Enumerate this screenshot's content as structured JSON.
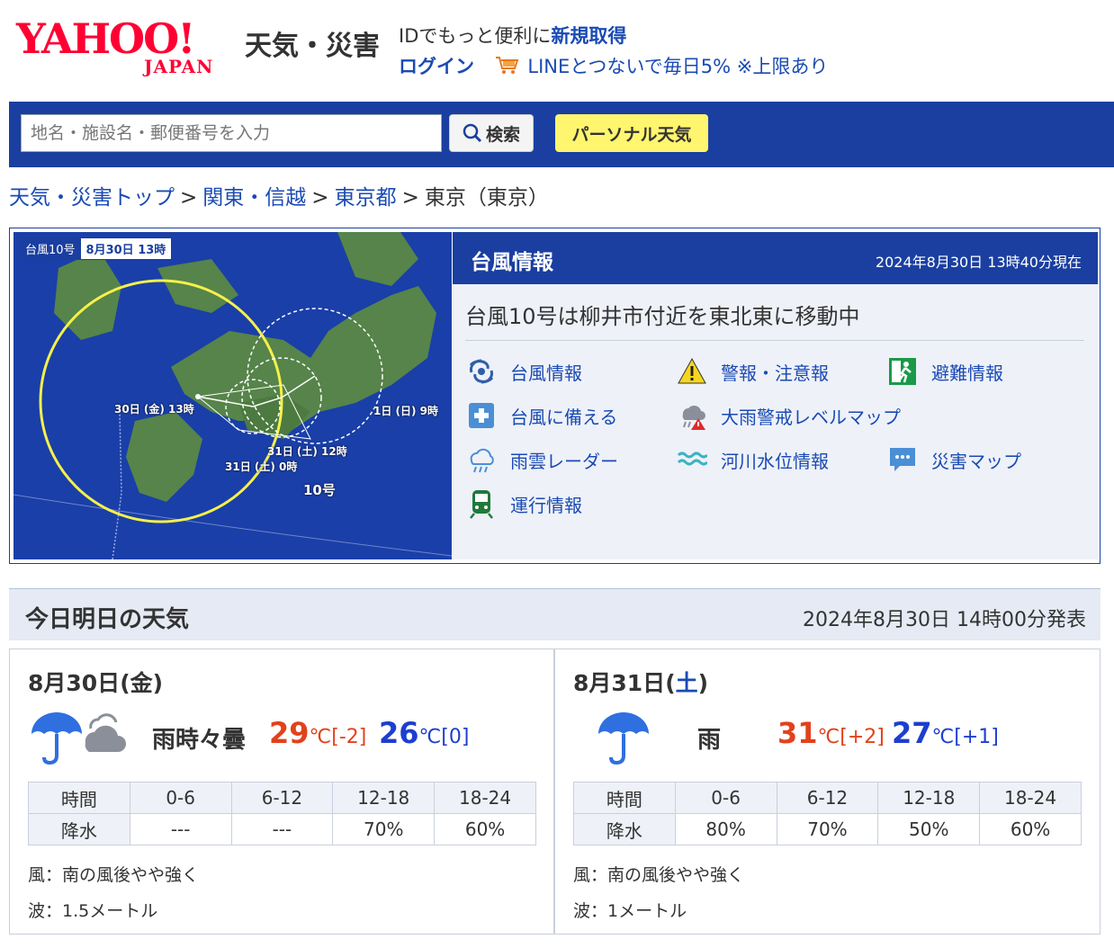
{
  "header": {
    "logo_text": "YAHOO!",
    "logo_sub": "JAPAN",
    "service_name": "天気・災害",
    "id_prompt": "IDでもっと便利に",
    "signup_label": "新規取得",
    "login_label": "ログイン",
    "line_promo": "LINEとつないで毎日5% ※上限あり"
  },
  "search": {
    "placeholder": "地名・施設名・郵便番号を入力",
    "button_label": "検索",
    "personal_label": "パーソナル天気"
  },
  "breadcrumb": {
    "items": [
      "天気・災害トップ",
      "関東・信越",
      "東京都"
    ],
    "current": "東京（東京）",
    "separator": ">"
  },
  "typhoon": {
    "map_label_name": "台風10号",
    "map_label_time": "8月30日 13時",
    "map_points": [
      "30日 (金) 13時",
      "31日 (土) 0時",
      "31日 (土) 12時",
      "1日 (日) 9時"
    ],
    "map_typhoon_name": "10号",
    "panel_title": "台風情報",
    "panel_time": "2024年8月30日 13時40分現在",
    "status": "台風10号は柳井市付近を東北東に移動中",
    "links": [
      {
        "label": "台風情報",
        "icon": "typhoon-icon"
      },
      {
        "label": "警報・注意報",
        "icon": "warning-icon"
      },
      {
        "label": "避難情報",
        "icon": "evacuation-icon"
      },
      {
        "label": "台風に備える",
        "icon": "first-aid-icon"
      },
      {
        "label": "大雨警戒レベルマップ",
        "icon": "heavy-rain-icon"
      },
      {
        "label": "雨雲レーダー",
        "icon": "rain-cloud-icon"
      },
      {
        "label": "河川水位情報",
        "icon": "river-icon"
      },
      {
        "label": "災害マップ",
        "icon": "chat-map-icon"
      },
      {
        "label": "運行情報",
        "icon": "train-icon"
      }
    ]
  },
  "forecast": {
    "title": "今日明日の天気",
    "issued": "2024年8月30日 14時00分発表",
    "days": [
      {
        "date": "8月30日",
        "dow_open": "(",
        "dow": "金",
        "dow_close": ")",
        "telop": "雨時々曇",
        "high": "29",
        "high_unit": "℃[-2]",
        "low": "26",
        "low_unit": "℃[0]",
        "precip_header": [
          "時間",
          "0-6",
          "6-12",
          "12-18",
          "18-24"
        ],
        "precip_values": [
          "降水",
          "---",
          "---",
          "70%",
          "60%"
        ],
        "wind": "風：南の風後やや強く",
        "wave": "波：1.5メートル",
        "icon": "rain-then-cloud-icon"
      },
      {
        "date": "8月31日",
        "dow_open": "(",
        "dow": "土",
        "dow_close": ")",
        "telop": "雨",
        "high": "31",
        "high_unit": "℃[+2]",
        "low": "27",
        "low_unit": "℃[+1]",
        "precip_header": [
          "時間",
          "0-6",
          "6-12",
          "12-18",
          "18-24"
        ],
        "precip_values": [
          "降水",
          "80%",
          "70%",
          "50%",
          "60%"
        ],
        "wind": "風：南の風後やや強く",
        "wave": "波：1メートル",
        "icon": "umbrella-icon"
      }
    ]
  },
  "colors": {
    "brand_red": "#ff0033",
    "nav_blue": "#1a3fa0",
    "link_blue": "#1a4ab3",
    "high_temp": "#e2421c",
    "low_temp": "#1d3fcf",
    "personal_yellow": "#fff56e"
  }
}
